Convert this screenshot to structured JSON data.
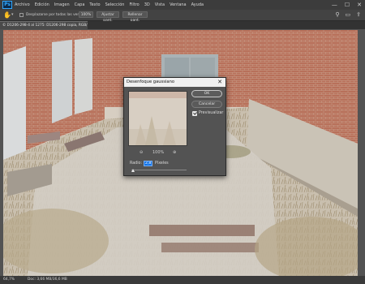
{
  "app": {
    "logo": "Ps"
  },
  "menu": [
    "Archivo",
    "Edición",
    "Imagen",
    "Capa",
    "Texto",
    "Selección",
    "Filtro",
    "3D",
    "Vista",
    "Ventana",
    "Ayuda"
  ],
  "window_controls": {
    "minimize": "—",
    "restore": "☐",
    "close": "✕"
  },
  "options_bar": {
    "scroll_all": "Desplazarse por todas las ventanas",
    "zoom_100": "100%",
    "fit_screen": "Ajustar pant.",
    "fill_screen": "Rellenar pant."
  },
  "document_tab": {
    "label": "© D1206-298-4 al 1275: D1206-298 copia, RGB/16) *"
  },
  "status": {
    "zoom": "64,7%",
    "doc_info": "Doc: 3,66 MB/36,6 MB"
  },
  "dialog": {
    "title": "Desenfoque gaussiano",
    "ok": "OK",
    "cancel": "Cancelar",
    "preview_label": "Previsualizar",
    "preview_checked": true,
    "zoom_level": "100%",
    "radius_label": "Radio:",
    "radius_value": "2,8",
    "radius_unit": "Píxeles",
    "slider_fraction": 0.04
  },
  "icons": [
    "photoshop-logo-icon",
    "hand-tool-icon",
    "search-icon",
    "workspace-icon",
    "share-icon",
    "zoom-out-icon",
    "zoom-in-icon",
    "close-icon"
  ]
}
